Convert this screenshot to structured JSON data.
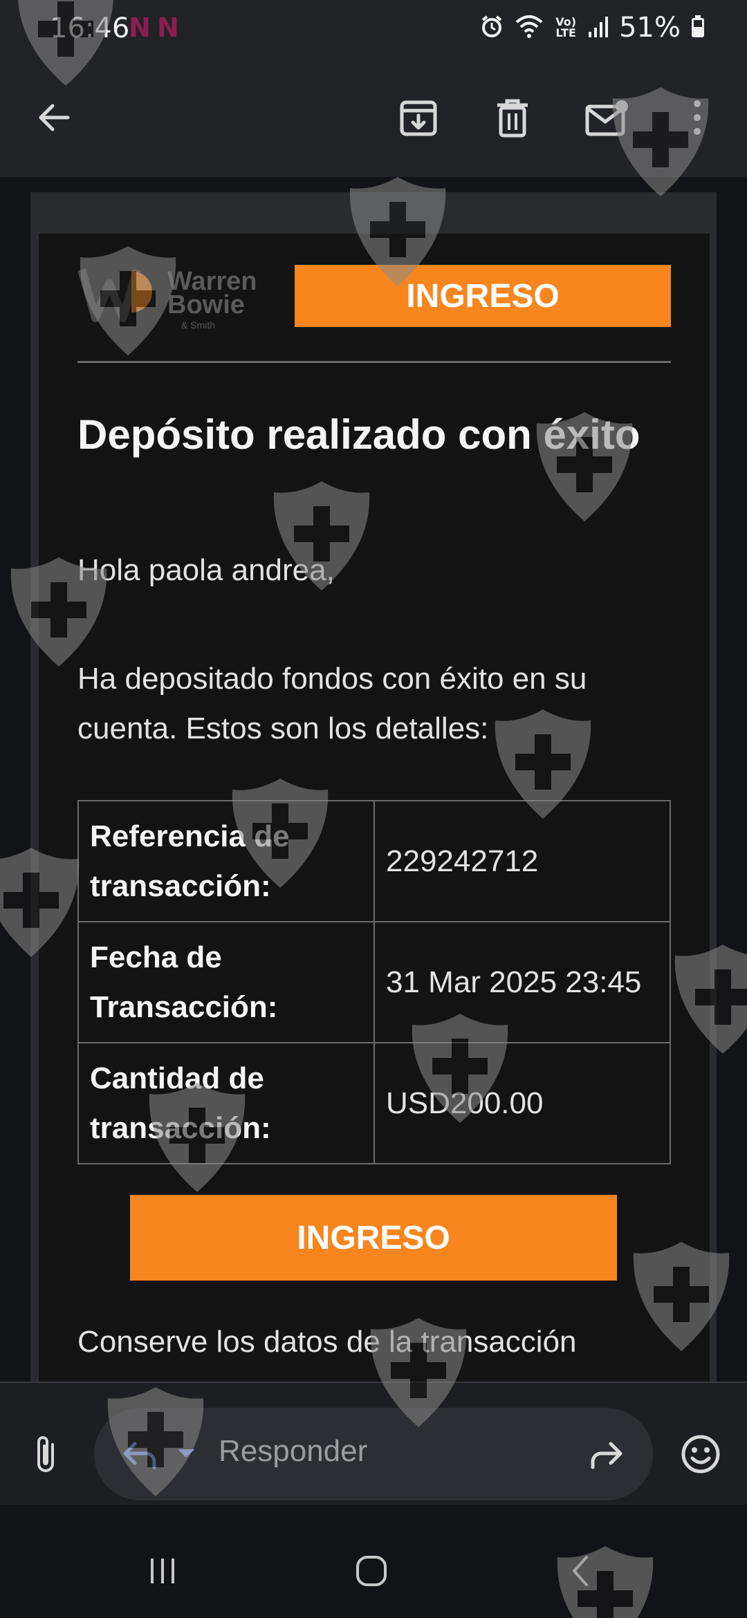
{
  "status_bar": {
    "time": "16:46",
    "notification_text": "N N",
    "volte_label": "Vo) LTE",
    "battery_percent": "51%"
  },
  "toolbar": {
    "icons": [
      "back-arrow-icon",
      "archive-icon",
      "delete-icon",
      "mark-unread-icon",
      "more-vert-icon"
    ]
  },
  "email": {
    "logo": {
      "line1": "Warren",
      "line2": "Bowie",
      "line3": "& Smith"
    },
    "badge_label": "INGRESO",
    "title": "Depósito realizado con éxito",
    "greeting": "Hola paola andrea,",
    "intro": "Ha depositado fondos con éxito en su cuenta. Estos son los detalles:",
    "details": [
      {
        "label": "Referencia de transacción:",
        "value": "229242712"
      },
      {
        "label": "Fecha de Transacción:",
        "value": "31 Mar 2025 23:45"
      },
      {
        "label": "Cantidad de transacción:",
        "value": "USD200.00"
      }
    ],
    "button_label": "INGRESO",
    "footer_note": "Conserve los datos de la transacción"
  },
  "reply_bar": {
    "placeholder": "Responder",
    "icons": [
      "attachment-icon",
      "reply-icon",
      "dropdown-icon",
      "forward-icon",
      "emoji-icon"
    ]
  },
  "nav_bar": {
    "icons": [
      "recent-apps-icon",
      "home-icon",
      "back-icon"
    ]
  },
  "colors": {
    "accent": "#f7861f",
    "background": "#131313",
    "toolbar": "#222327"
  }
}
